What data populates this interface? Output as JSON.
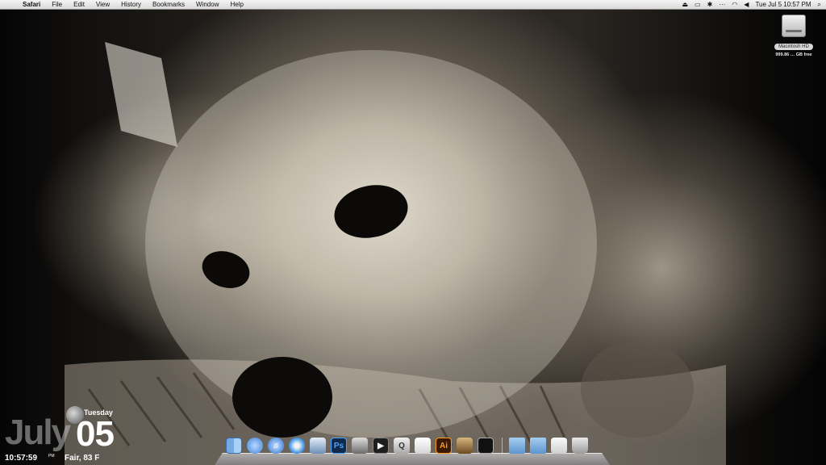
{
  "menubar": {
    "apple_glyph": "",
    "items": [
      "Safari",
      "File",
      "Edit",
      "View",
      "History",
      "Bookmarks",
      "Window",
      "Help"
    ],
    "status_icons": [
      "eject-icon",
      "battery-icon",
      "bluetooth-icon",
      "dots-icon",
      "wifi-icon",
      "volume-icon",
      "spotlight-icon"
    ],
    "clock": "Tue Jul 5  10:57 PM"
  },
  "desktop": {
    "disk": {
      "name": "Macintosh HD",
      "free": "999.86 … GB free"
    }
  },
  "widget": {
    "month": "July",
    "day": "05",
    "weekday": "Tuesday",
    "time": "10:57:59",
    "ampm": "PM",
    "weather": "Fair, 83 F"
  },
  "dock": {
    "apps": [
      {
        "name": "finder",
        "glyph": ""
      },
      {
        "name": "ichat",
        "glyph": ""
      },
      {
        "name": "itunes",
        "glyph": "♫"
      },
      {
        "name": "safari",
        "glyph": ""
      },
      {
        "name": "preview",
        "glyph": ""
      },
      {
        "name": "photoshop",
        "glyph": "Ps"
      },
      {
        "name": "script-editor",
        "glyph": ""
      },
      {
        "name": "dvd-player",
        "glyph": "▶"
      },
      {
        "name": "quicktime",
        "glyph": "Q"
      },
      {
        "name": "ical",
        "glyph": ""
      },
      {
        "name": "illustrator",
        "glyph": "Ai"
      },
      {
        "name": "iphoto",
        "glyph": ""
      },
      {
        "name": "activity-monitor",
        "glyph": ""
      }
    ],
    "stacks": [
      {
        "name": "applications-folder",
        "glyph": ""
      },
      {
        "name": "documents-folder",
        "glyph": ""
      },
      {
        "name": "mail",
        "glyph": ""
      },
      {
        "name": "trash",
        "glyph": ""
      }
    ]
  },
  "colors": {
    "menubar": "#e6e6e6",
    "wallpaper_tone": "sepia"
  }
}
